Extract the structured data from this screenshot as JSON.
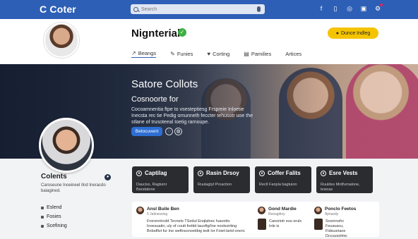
{
  "app": {
    "logo": "C Coter"
  },
  "search": {
    "placeholder": "Search"
  },
  "profile": {
    "name": "Nignterial",
    "follow_label": "Dunce Indleg",
    "tabs": [
      {
        "label": "Beangs",
        "icon": "chart-icon"
      },
      {
        "label": "Funies",
        "icon": "pen-icon"
      },
      {
        "label": "Corting",
        "icon": "heart-icon"
      },
      {
        "label": "Pamilies",
        "icon": "document-icon"
      },
      {
        "label": "Artices",
        "icon": ""
      }
    ]
  },
  "banner": {
    "title": "Satore Collots",
    "subtitle": "Cosnoorte for",
    "description": "Cocoamnentia ftpe to vsesteptiesg Frspreie Inloetie Inecsta rec tie Pedig omunneth feccter tehusotr uoe the stlane of trusoteeal Ioetig rarnoupe.",
    "button_label": "Betocuvent"
  },
  "sidebar": {
    "name": "Colents",
    "description": "Caroseune Inoeineel Ilnd Ineracdo baiagined.",
    "links": [
      "Eslend",
      "Fosies",
      "Scefining"
    ]
  },
  "cards": [
    {
      "title": "Captilag",
      "subtitle": "Dauciss, Ragtuinr Bandatone"
    },
    {
      "title": "Rasin Drsoy",
      "subtitle": "Ruulagtyt Proaction"
    },
    {
      "title": "Coffer Falits",
      "subtitle": "Reclt Fanpla bagtuion"
    },
    {
      "title": "Esre Vests",
      "subtitle": "Ruuldes Mrdfurnalone, tesicas"
    }
  ],
  "feed": [
    {
      "author": "Ansl Buile Ben",
      "meta": "5 Jatinessing",
      "text": "Froronntrcdd Tecnets TSedul Enqlalnec fuavotto Inoesuatin, uly of coutt frettid tauoftg/Ine noolsvirting Bnlodfivt fur Ine weftnsonoetibig tedt Ior Foiet-lartd oneni."
    },
    {
      "author": "Gond Mardie",
      "meta": "Reosgdiny",
      "text": "Cansriotr eus oruls Inle is"
    },
    {
      "author": "Ponclo Feetos",
      "meta": "Ajmaxdy",
      "text": "Sosrnnsfrc Feuavacu, Fidsusriaoe Dccuusolme."
    }
  ]
}
